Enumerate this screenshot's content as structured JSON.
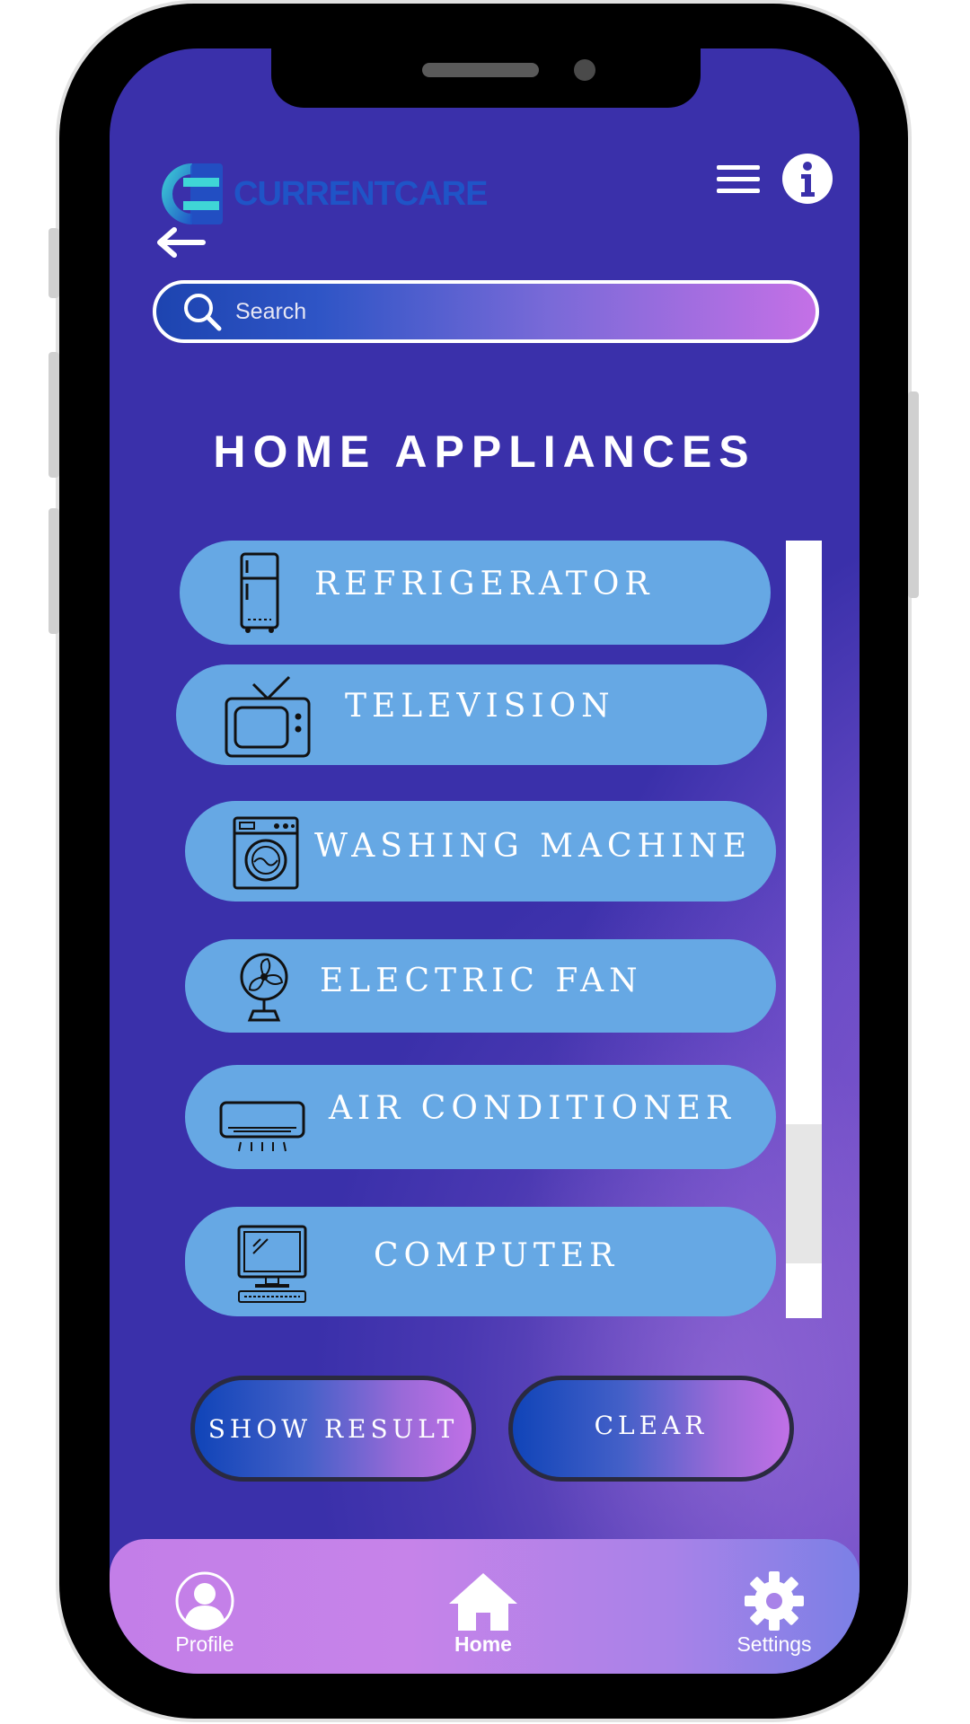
{
  "app": {
    "logo_text": "CURRENTCARE",
    "page_title": "HOME APPLIANCES"
  },
  "search": {
    "placeholder": "Search",
    "value": ""
  },
  "appliances": [
    {
      "label": "REFRIGERATOR",
      "icon": "refrigerator-icon"
    },
    {
      "label": "TELEVISION",
      "icon": "television-icon"
    },
    {
      "label": "WASHING MACHINE",
      "icon": "washing-machine-icon"
    },
    {
      "label": "ELECTRIC FAN",
      "icon": "electric-fan-icon"
    },
    {
      "label": "AIR CONDITIONER",
      "icon": "air-conditioner-icon"
    },
    {
      "label": "COMPUTER",
      "icon": "computer-icon"
    }
  ],
  "actions": {
    "show_result": "SHOW RESULT",
    "clear": "CLEAR"
  },
  "nav": {
    "profile": "Profile",
    "home": "Home",
    "settings": "Settings",
    "active": "home"
  },
  "colors": {
    "background": "#3a30aa",
    "item_fill": "#66a8e4",
    "logo_blue": "#1f54c7",
    "nav_gradient_start": "#c37ee8",
    "nav_gradient_end": "#7b80e6"
  }
}
